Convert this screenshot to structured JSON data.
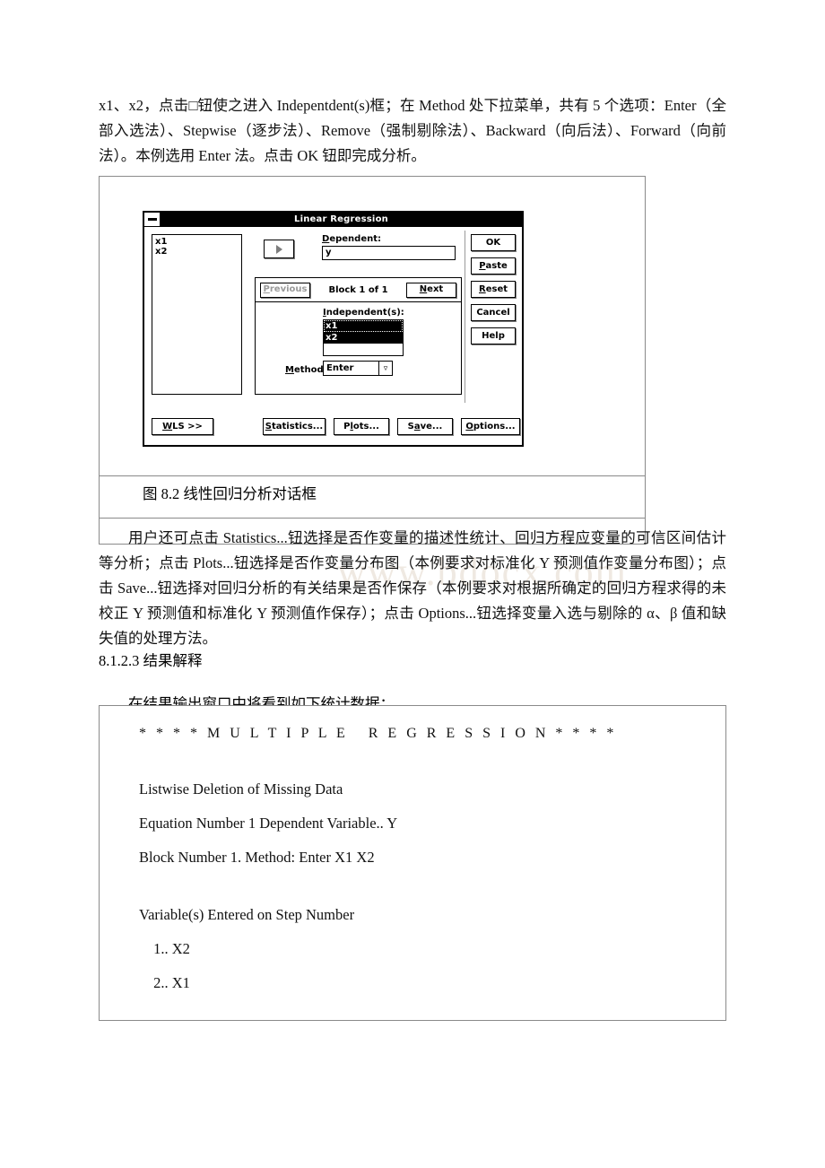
{
  "document": {
    "intro_paragraph": "x1、x2，点击□钮使之进入 Indepentdent(s)框；在 Method 处下拉菜单，共有 5 个选项：Enter（全部入选法）、Stepwise（逐步法）、Remove（强制剔除法）、Backward（向后法）、Forward（向前法）。本例选用 Enter 法。点击 OK 钮即完成分析。",
    "figure_caption": "图 8.2 线性回归分析对话框",
    "watermark": "www.bdocx.com",
    "paragraph_after_figure": "用户还可点击 Statistics...钮选择是否作变量的描述性统计、回归方程应变量的可信区间估计等分析；点击 Plots...钮选择是否作变量分布图（本例要求对标准化 Y 预测值作变量分布图）；点击 Save...钮选择对回归分析的有关结果是否作保存（本例要求对根据所确定的回归方程求得的未校正 Y 预测值和标准化 Y 预测值作保存）；点击 Options...钮选择变量入选与剔除的 α、β 值和缺失值的处理方法。",
    "section_heading": "8.1.2.3 结果解释",
    "paragraph_before_output": "在结果输出窗口中将看到如下统计数据："
  },
  "dialog": {
    "title": "Linear Regression",
    "sysmenu_icon": "minimize-box-icon",
    "source_variables": [
      "x1",
      "x2"
    ],
    "move_right_button": {
      "icon": "arrow-right-icon",
      "enabled": false
    },
    "move_left_button": {
      "icon": "arrow-left-icon",
      "enabled": true
    },
    "dependent": {
      "label_prefix": "",
      "label_accel": "D",
      "label_suffix": "ependent:",
      "value": "y"
    },
    "block": {
      "previous_prefix": "",
      "previous_accel": "P",
      "previous_suffix": "revious",
      "previous_enabled": false,
      "status": "Block 1 of 1",
      "next_prefix": "",
      "next_accel": "N",
      "next_suffix": "ext"
    },
    "independents": {
      "label_prefix": "",
      "label_accel": "I",
      "label_suffix": "ndependent(s):",
      "items": [
        "x1",
        "x2"
      ]
    },
    "method": {
      "label_prefix": "",
      "label_accel": "M",
      "label_suffix": "ethod:",
      "value": "Enter",
      "dropdown_icon": "chevron-down-icon",
      "options": [
        "Enter",
        "Stepwise",
        "Remove",
        "Backward",
        "Forward"
      ]
    },
    "command_buttons": [
      {
        "label": "OK",
        "accel": "",
        "prefix": "OK",
        "suffix": ""
      },
      {
        "prefix": "",
        "accel": "P",
        "suffix": "aste"
      },
      {
        "prefix": "",
        "accel": "R",
        "suffix": "eset"
      },
      {
        "prefix": "Cancel",
        "accel": "",
        "suffix": ""
      },
      {
        "prefix": "Help",
        "accel": "",
        "suffix": ""
      }
    ],
    "bottom_buttons": {
      "wls": {
        "prefix": "",
        "accel": "W",
        "suffix": "LS >>"
      },
      "stats": {
        "prefix": "",
        "accel": "S",
        "suffix": "tatistics..."
      },
      "plots": {
        "prefix": "P",
        "accel": "l",
        "suffix": "ots..."
      },
      "save": {
        "prefix": "S",
        "accel": "a",
        "suffix": "ve..."
      },
      "options": {
        "prefix": "",
        "accel": "O",
        "suffix": "ptions..."
      }
    }
  },
  "output": {
    "title": "* * * * M U L T I P L E   R E G R E S S I O N * * * *",
    "lines": [
      "Listwise Deletion of Missing Data",
      "Equation Number 1 Dependent Variable.. Y",
      "Block Number 1. Method: Enter X1 X2"
    ],
    "step_header": "Variable(s) Entered on Step Number",
    "steps": [
      " 1.. X2",
      " 2.. X1"
    ]
  }
}
